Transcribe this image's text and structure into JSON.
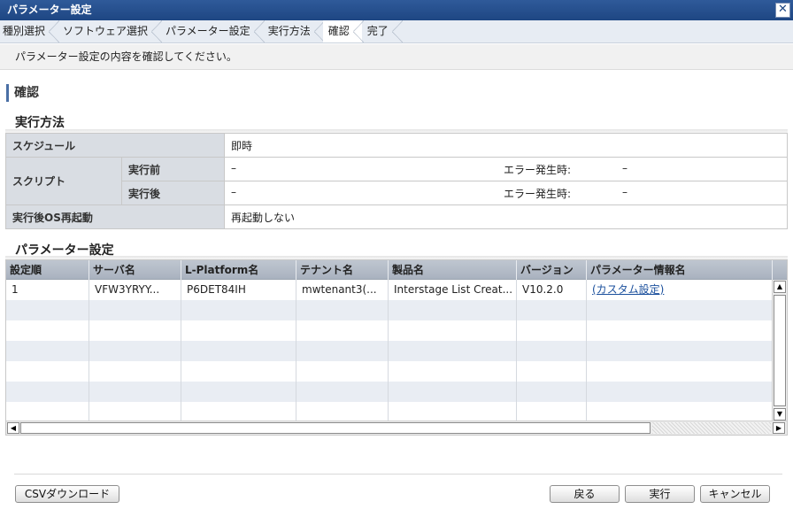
{
  "window": {
    "title": "パラメーター設定",
    "close_glyph": "✕"
  },
  "steps": [
    "種別選択",
    "ソフトウェア選択",
    "パラメーター設定",
    "実行方法",
    "確認",
    "完了"
  ],
  "active_step": 4,
  "instruction": "パラメーター設定の内容を確認してください。",
  "section_title": "確認",
  "execution": {
    "heading": "実行方法",
    "schedule_label": "スケジュール",
    "schedule_value": "即時",
    "script_label": "スクリプト",
    "pre_label": "実行前",
    "pre_value": "–",
    "pre_error_label": "エラー発生時:",
    "pre_error_value": "–",
    "post_label": "実行後",
    "post_value": "–",
    "post_error_label": "エラー発生時:",
    "post_error_value": "–",
    "reboot_label": "実行後OS再起動",
    "reboot_value": "再起動しない"
  },
  "params": {
    "heading": "パラメーター設定",
    "columns": [
      "設定順",
      "サーバ名",
      "L-Platform名",
      "テナント名",
      "製品名",
      "バージョン",
      "パラメーター情報名"
    ],
    "rows": [
      [
        "1",
        "VFW3YRYY...",
        "P6DET84IH",
        "mwtenant3(...",
        "Interstage List Creat...",
        "V10.2.0",
        "(カスタム設定)"
      ]
    ]
  },
  "buttons": {
    "csv": "CSVダウンロード",
    "back": "戻る",
    "execute": "実行",
    "cancel": "キャンセル"
  },
  "colors": {
    "titlebar": "#1e4683",
    "header_cell": "#d9dde3",
    "grid_header": "#a9b2bf",
    "alt_row": "#e9edf3",
    "link": "#1a4f9c"
  }
}
